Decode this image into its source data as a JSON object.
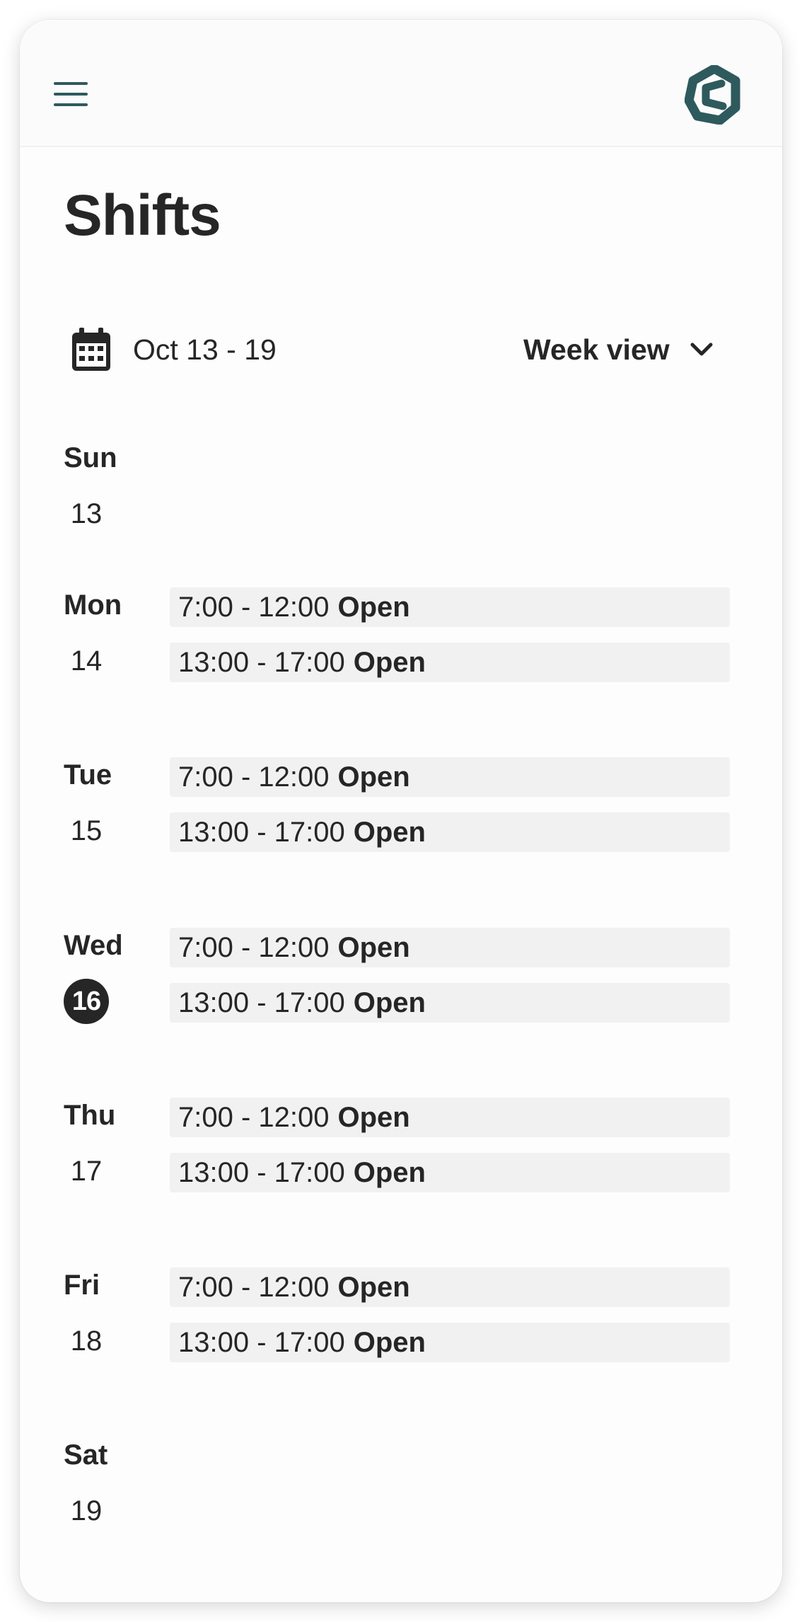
{
  "app": {
    "title": "Shifts",
    "logo_icon": "app-logo-icon",
    "brand_color": "#2e5a5e"
  },
  "header": {
    "menu_icon": "hamburger-menu-icon"
  },
  "toolbar": {
    "date_range": "Oct 13 - 19",
    "calendar_icon": "calendar-icon",
    "view_label": "Week view",
    "view_icon": "chevron-down-icon"
  },
  "days": [
    {
      "name": "Sun",
      "date": "13",
      "today": false,
      "shifts": []
    },
    {
      "name": "Mon",
      "date": "14",
      "today": false,
      "shifts": [
        {
          "time": "7:00 - 12:00",
          "status": "Open"
        },
        {
          "time": "13:00 - 17:00",
          "status": "Open"
        }
      ]
    },
    {
      "name": "Tue",
      "date": "15",
      "today": false,
      "shifts": [
        {
          "time": "7:00 - 12:00",
          "status": "Open"
        },
        {
          "time": "13:00 - 17:00",
          "status": "Open"
        }
      ]
    },
    {
      "name": "Wed",
      "date": "16",
      "today": true,
      "shifts": [
        {
          "time": "7:00 - 12:00",
          "status": "Open"
        },
        {
          "time": "13:00 - 17:00",
          "status": "Open"
        }
      ]
    },
    {
      "name": "Thu",
      "date": "17",
      "today": false,
      "shifts": [
        {
          "time": "7:00 - 12:00",
          "status": "Open"
        },
        {
          "time": "13:00 - 17:00",
          "status": "Open"
        }
      ]
    },
    {
      "name": "Fri",
      "date": "18",
      "today": false,
      "shifts": [
        {
          "time": "7:00 - 12:00",
          "status": "Open"
        },
        {
          "time": "13:00 - 17:00",
          "status": "Open"
        }
      ]
    },
    {
      "name": "Sat",
      "date": "19",
      "today": false,
      "shifts": []
    }
  ]
}
